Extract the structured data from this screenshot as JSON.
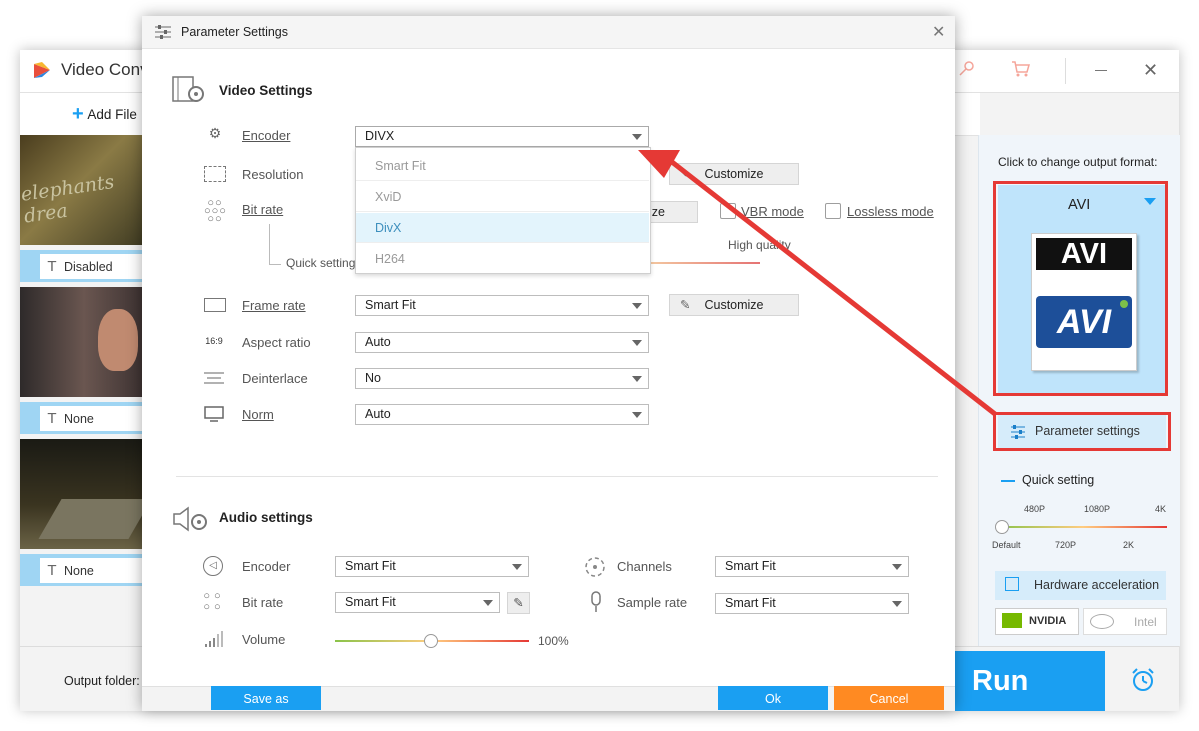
{
  "app": {
    "title": "Video Conv",
    "add_files": "Add File",
    "output_folder_label": "Output folder:",
    "run_label": "Run",
    "files": [
      {
        "subtitle": "Disabled"
      },
      {
        "subtitle": "None"
      },
      {
        "subtitle": "None"
      }
    ],
    "right_panel": {
      "output_hint": "Click to change output format:",
      "format_name": "AVI",
      "format_icon_top": "AVI",
      "format_icon_bottom": "AVI",
      "param_settings": "Parameter settings",
      "quick_setting": "Quick setting",
      "quality_top": [
        "480P",
        "1080P",
        "4K"
      ],
      "quality_bottom": [
        "Default",
        "720P",
        "2K"
      ],
      "hw_accel": "Hardware acceleration",
      "nvidia": "NVIDIA",
      "intel": "Intel"
    }
  },
  "dialog": {
    "title": "Parameter Settings",
    "video_heading": "Video Settings",
    "audio_heading": "Audio settings",
    "video": {
      "encoder_label": "Encoder",
      "encoder_value": "DIVX",
      "encoder_options": [
        "Smart Fit",
        "XviD",
        "DivX",
        "H264"
      ],
      "encoder_highlighted": "DivX",
      "resolution_label": "Resolution",
      "bitrate_label": "Bit rate",
      "quick_setting_label": "Quick setting",
      "high_quality_label": "High quality",
      "customize_partial": "ize",
      "vbr_label": "VBR mode",
      "lossless_label": "Lossless mode",
      "framerate_label": "Frame rate",
      "framerate_value": "Smart Fit",
      "aspect_label": "Aspect ratio",
      "aspect_icon_text": "16:9",
      "aspect_value": "Auto",
      "deinterlace_label": "Deinterlace",
      "deinterlace_value": "No",
      "norm_label": "Norm",
      "norm_value": "Auto",
      "customize_label": "Customize"
    },
    "audio": {
      "encoder_label": "Encoder",
      "encoder_value": "Smart Fit",
      "bitrate_label": "Bit rate",
      "bitrate_value": "Smart Fit",
      "volume_label": "Volume",
      "volume_value": "100%",
      "volume_level": 0.49,
      "channels_label": "Channels",
      "channels_value": "Smart Fit",
      "samplerate_label": "Sample rate",
      "samplerate_value": "Smart Fit"
    },
    "buttons": {
      "save_as": "Save as",
      "ok": "Ok",
      "cancel": "Cancel"
    }
  },
  "colors": {
    "accent_blue": "#1a9ff2",
    "cancel_orange": "#ff8a22",
    "annotation_red": "#e53935",
    "selected_format_bg": "#bfe4fb"
  }
}
